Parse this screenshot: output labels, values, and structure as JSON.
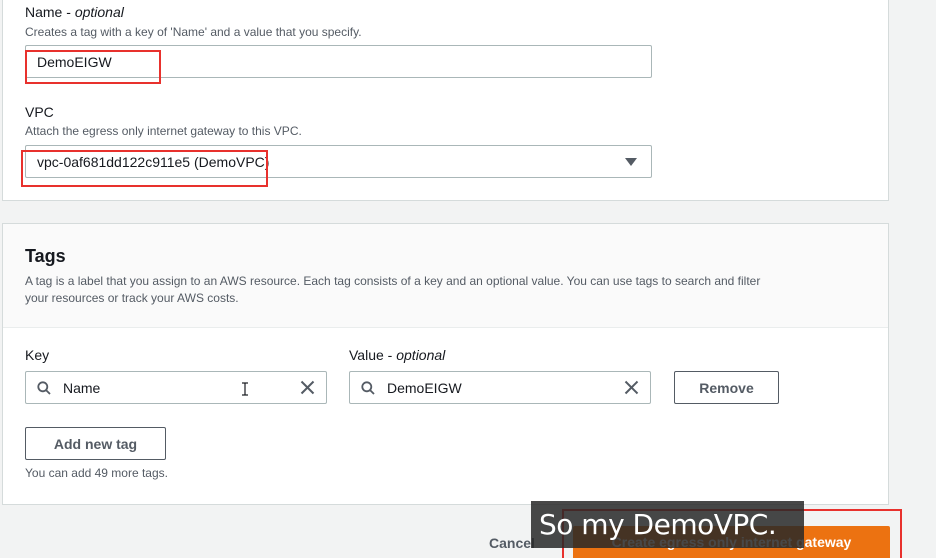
{
  "name_field": {
    "label": "Name",
    "label_suffix": "optional",
    "description": "Creates a tag with a key of 'Name' and a value that you specify.",
    "value": "DemoEIGW"
  },
  "vpc_field": {
    "label": "VPC",
    "description": "Attach the egress only internet gateway to this VPC.",
    "selected": "vpc-0af681dd122c911e5 (DemoVPC)"
  },
  "tags": {
    "title": "Tags",
    "description_line1": "A tag is a label that you assign to an AWS resource. Each tag consists of a key and an optional value. You can use tags to search and filter",
    "description_line2": "your resources or track your AWS costs.",
    "key_label": "Key",
    "value_label": "Value",
    "value_label_suffix": "optional",
    "key_value": "Name",
    "value_value": "DemoEIGW",
    "remove_label": "Remove",
    "add_label": "Add new tag",
    "remaining": "You can add 49 more tags."
  },
  "footer": {
    "cancel_label": "Cancel",
    "create_label": "Create egress only internet gateway"
  },
  "caption": "So my DemoVPC.",
  "colors": {
    "primary": "#ec7211",
    "highlight": "#e8312d",
    "border": "#aab7b8"
  }
}
